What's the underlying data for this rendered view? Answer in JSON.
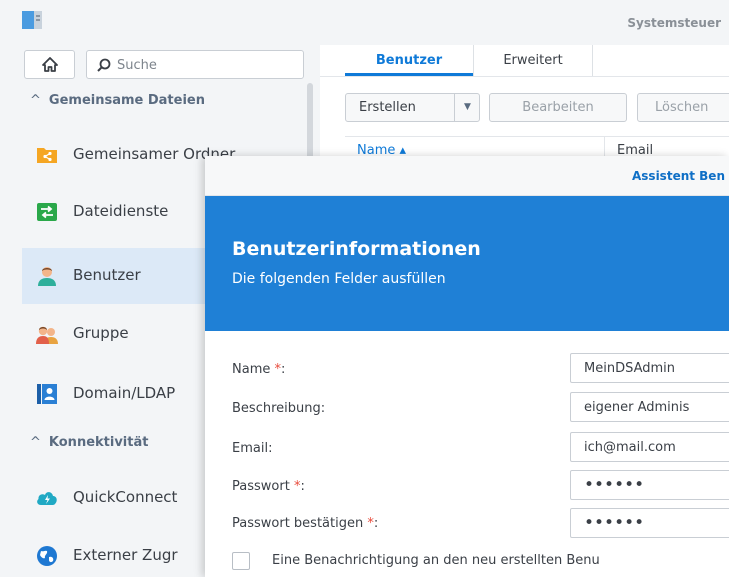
{
  "window": {
    "title": "Systemsteuer"
  },
  "sidebar": {
    "search_placeholder": "Suche",
    "sections": [
      {
        "label": "Gemeinsame Dateien"
      },
      {
        "label": "Konnektivität"
      }
    ],
    "items": [
      {
        "label": "Gemeinsamer Ordner",
        "icon": "shared-folder-icon",
        "active": false
      },
      {
        "label": "Dateidienste",
        "icon": "file-services-icon",
        "active": false
      },
      {
        "label": "Benutzer",
        "icon": "user-icon",
        "active": true
      },
      {
        "label": "Gruppe",
        "icon": "group-icon",
        "active": false
      },
      {
        "label": "Domain/LDAP",
        "icon": "domain-ldap-icon",
        "active": false
      },
      {
        "label": "QuickConnect",
        "icon": "quickconnect-icon",
        "active": false
      },
      {
        "label": "Externer Zugr",
        "icon": "external-access-icon",
        "active": false
      }
    ]
  },
  "main": {
    "tabs": [
      {
        "label": "Benutzer",
        "active": true
      },
      {
        "label": "Erweitert",
        "active": false
      }
    ],
    "toolbar": {
      "create_label": "Erstellen",
      "edit_label": "Bearbeiten",
      "delete_label": "Löschen"
    },
    "grid": {
      "columns": [
        {
          "label": "Name ▴"
        },
        {
          "label": "Email"
        }
      ]
    }
  },
  "dialog": {
    "title": "Assistent Ben",
    "heading": "Benutzerinformationen",
    "subheading": "Die folgenden Felder ausfüllen",
    "fields": [
      {
        "label": "Name",
        "required": true,
        "value": "MeinDSAdmin"
      },
      {
        "label": "Beschreibung:",
        "required": false,
        "value": "eigener Adminis"
      },
      {
        "label": "Email:",
        "required": false,
        "value": "ich@mail.com"
      },
      {
        "label": "Passwort",
        "required": true,
        "value": "••••••"
      },
      {
        "label": "Passwort bestätigen",
        "required": true,
        "value": "••••••"
      }
    ],
    "required_marker": "*",
    "required_suffix": ":",
    "notify_label": "Eine Benachrichtigung an den neu erstellten Benu"
  },
  "colors": {
    "accent": "#0f7ad8",
    "banner": "#1f80d6",
    "required": "#e84a3b",
    "sidebar_bg": "#f3f5f7",
    "active_item_bg": "#dce9f7"
  }
}
